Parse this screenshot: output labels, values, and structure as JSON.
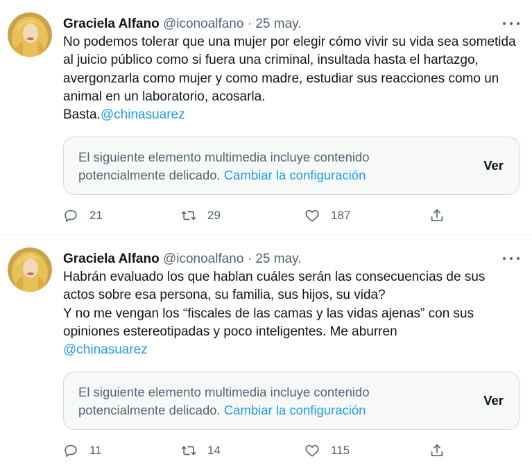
{
  "tweets": [
    {
      "author_name": "Graciela Alfano",
      "handle": "@iconoalfano",
      "separator": "·",
      "date": "25 may.",
      "body_lines": [
        "No podemos tolerar que una mujer por elegir cómo vivir su vida sea sometida al juicio público como si fuera una criminal, insultada hasta el hartazgo, avergonzarla como mujer y como madre, estudiar sus reacciones como un animal en un laboratorio, acosarla."
      ],
      "closing_text": "Basta.",
      "mention": "@chinasuarez",
      "sensitive_notice": "El siguiente elemento multimedia incluye contenido potencialmente delicado.",
      "sensitive_link": "Cambiar la configuración",
      "view_label": "Ver",
      "reply_count": "21",
      "retweet_count": "29",
      "like_count": "187",
      "icons": {
        "more": "more-dots-icon",
        "reply": "reply-icon",
        "retweet": "retweet-icon",
        "like": "heart-icon",
        "share": "share-icon"
      }
    },
    {
      "author_name": "Graciela Alfano",
      "handle": "@iconoalfano",
      "separator": "·",
      "date": "25 may.",
      "paragraph_1": "Habrán evaluado los que hablan cuáles serán las consecuencias de sus actos sobre esa persona, su familia, sus hijos, su vida?",
      "paragraph_2": "Y no me vengan los “fiscales de las camas y las vidas ajenas” con sus opiniones estereotipadas y poco inteligentes. Me aburren",
      "mention": "@chinasuarez",
      "sensitive_notice": "El siguiente elemento multimedia incluye contenido potencialmente delicado.",
      "sensitive_link": "Cambiar la configuración",
      "view_label": "Ver",
      "reply_count": "11",
      "retweet_count": "14",
      "like_count": "115"
    }
  ],
  "colors": {
    "text": "#0f1419",
    "secondary": "#536471",
    "link": "#1d9bf0",
    "border": "#cfd9de"
  }
}
